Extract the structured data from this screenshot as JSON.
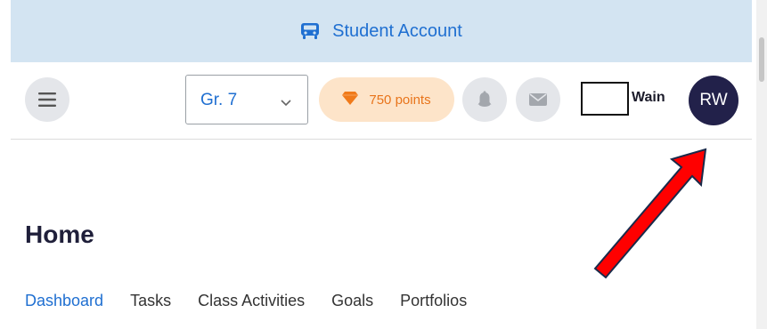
{
  "banner": {
    "icon": "bus-icon",
    "label": "Student Account"
  },
  "header": {
    "menu_icon": "hamburger-menu-icon",
    "grade_select": {
      "value": "Gr. 7",
      "icon": "chevron-down-icon"
    },
    "points": {
      "icon": "gem-icon",
      "label": "750 points"
    },
    "notifications_icon": "bell-icon",
    "messages_icon": "mail-icon",
    "user_name": "Wain",
    "avatar_initials": "RW"
  },
  "main": {
    "title": "Home",
    "tabs": [
      {
        "label": "Dashboard",
        "active": true
      },
      {
        "label": "Tasks"
      },
      {
        "label": "Class Activities"
      },
      {
        "label": "Goals"
      },
      {
        "label": "Portfolios"
      }
    ]
  },
  "annotation": {
    "icon": "red-arrow-pointer-icon"
  },
  "colors": {
    "accent": "#1f6fd1",
    "banner_bg": "#d3e4f2",
    "points_bg": "#fde4c9",
    "points_text": "#e8741b",
    "avatar_bg": "#22214a",
    "arrow": "#ff0000"
  }
}
